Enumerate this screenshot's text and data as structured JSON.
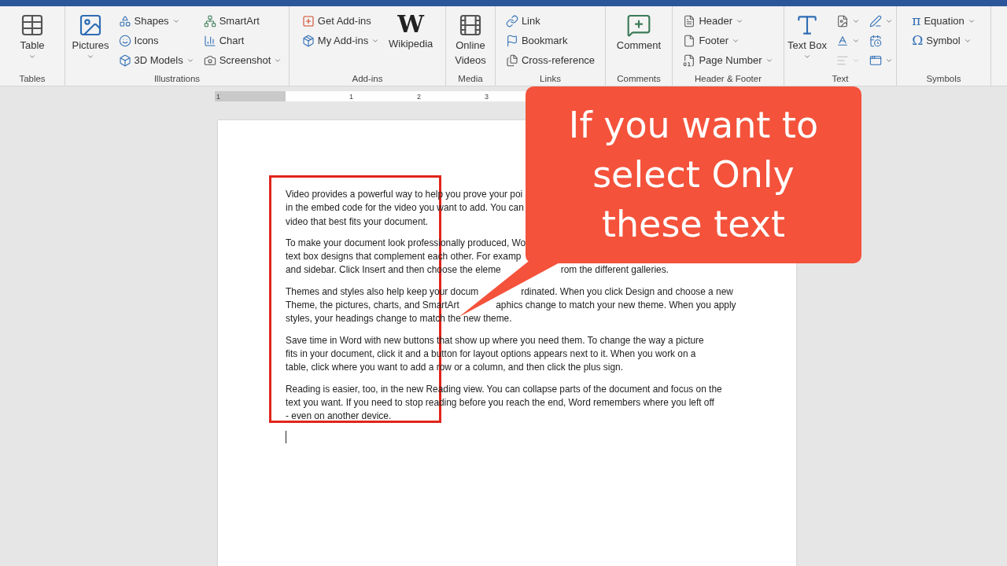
{
  "ribbon": {
    "groups": [
      {
        "label": "Tables",
        "columns": [
          {
            "kind": "large",
            "items": [
              {
                "label": "Table",
                "dropdown": true
              }
            ]
          }
        ]
      },
      {
        "label": "Illustrations",
        "columns": [
          {
            "kind": "large",
            "items": [
              {
                "label": "Pictures",
                "dropdown": true
              }
            ]
          },
          {
            "kind": "stack",
            "items": [
              {
                "label": "Shapes",
                "dropdown": true
              },
              {
                "label": "Icons",
                "dropdown": false
              },
              {
                "label": "3D Models",
                "dropdown": true
              }
            ]
          },
          {
            "kind": "stack",
            "items": [
              {
                "label": "SmartArt",
                "dropdown": false
              },
              {
                "label": "Chart",
                "dropdown": false
              },
              {
                "label": "Screenshot",
                "dropdown": true
              }
            ]
          }
        ]
      },
      {
        "label": "Add-ins",
        "columns": [
          {
            "kind": "stack",
            "items": [
              {
                "label": "Get Add-ins",
                "dropdown": false
              },
              {
                "label": "My Add-ins",
                "dropdown": true
              }
            ]
          },
          {
            "kind": "large",
            "items": [
              {
                "label": "Wikipedia",
                "glyph": "W",
                "dropdown": false
              }
            ]
          }
        ]
      },
      {
        "label": "Media",
        "columns": [
          {
            "kind": "large",
            "items": [
              {
                "label": "Online Videos",
                "dropdown": false
              }
            ]
          }
        ]
      },
      {
        "label": "Links",
        "columns": [
          {
            "kind": "stack",
            "items": [
              {
                "label": "Link",
                "dropdown": false
              },
              {
                "label": "Bookmark",
                "dropdown": false
              },
              {
                "label": "Cross-reference",
                "dropdown": false
              }
            ]
          }
        ]
      },
      {
        "label": "Comments",
        "columns": [
          {
            "kind": "large",
            "items": [
              {
                "label": "Comment",
                "dropdown": false
              }
            ]
          }
        ]
      },
      {
        "label": "Header & Footer",
        "columns": [
          {
            "kind": "stack",
            "items": [
              {
                "label": "Header",
                "dropdown": true
              },
              {
                "label": "Footer",
                "dropdown": true
              },
              {
                "label": "Page Number",
                "dropdown": true
              }
            ]
          }
        ]
      },
      {
        "label": "Text",
        "columns": [
          {
            "kind": "large",
            "items": [
              {
                "label": "Text Box",
                "dropdown": true
              }
            ]
          },
          {
            "kind": "stack",
            "items": [
              {
                "dropdown": true,
                "disabled": false
              },
              {
                "dropdown": true,
                "disabled": false
              },
              {
                "dropdown": true,
                "disabled": true
              }
            ]
          },
          {
            "kind": "stack",
            "items": [
              {
                "dropdown": true,
                "disabled": false
              },
              {
                "dropdown": false,
                "disabled": false
              },
              {
                "dropdown": true,
                "disabled": false
              }
            ]
          }
        ]
      },
      {
        "label": "Symbols",
        "columns": [
          {
            "kind": "stack",
            "items": [
              {
                "label": "Equation",
                "glyph": "π",
                "dropdown": true
              },
              {
                "label": "Symbol",
                "glyph": "Ω",
                "dropdown": true
              }
            ]
          }
        ]
      }
    ]
  },
  "ruler": {
    "labels": [
      "1",
      "1",
      "2",
      "3"
    ]
  },
  "document": {
    "paragraphs": [
      {
        "lines": [
          [
            "Video provides a powerful way to help you prove your poi"
          ],
          [
            "in the embed code for the video you want to add. You can"
          ],
          [
            "video that best fits your document."
          ]
        ]
      },
      {
        "lines": [
          [
            "To make your document look professionally produced, Wo"
          ],
          [
            "text box designs that complement each other. For examp"
          ],
          [
            "and sidebar. Click Insert and then choose the eleme",
            "rom the different galleries."
          ]
        ]
      },
      {
        "lines": [
          [
            "Themes and styles also help keep your docum",
            "rdinated. When you click Design and choose a new"
          ],
          [
            "Theme, the pictures, charts, and SmartArt",
            "aphics change to match your new theme. When you apply"
          ],
          [
            "styles, your headings change to match the new theme."
          ]
        ]
      },
      {
        "lines": [
          [
            "Save time in Word with new buttons that show up where you need them. To change the way a picture"
          ],
          [
            "fits in your document, click it and a button for layout options appears next to it. When you work on a"
          ],
          [
            "table, click where you want to add a row or a column, and then click the plus sign."
          ]
        ]
      },
      {
        "lines": [
          [
            "Reading is easier, too, in the new Reading view. You can collapse parts of the document and focus on the"
          ],
          [
            "text you want. If you need to stop reading before you reach the end, Word remembers where you left off"
          ],
          [
            "- even on another device."
          ]
        ]
      }
    ]
  },
  "callout": {
    "lines": [
      "If you want to",
      "select Only",
      "these text"
    ]
  }
}
